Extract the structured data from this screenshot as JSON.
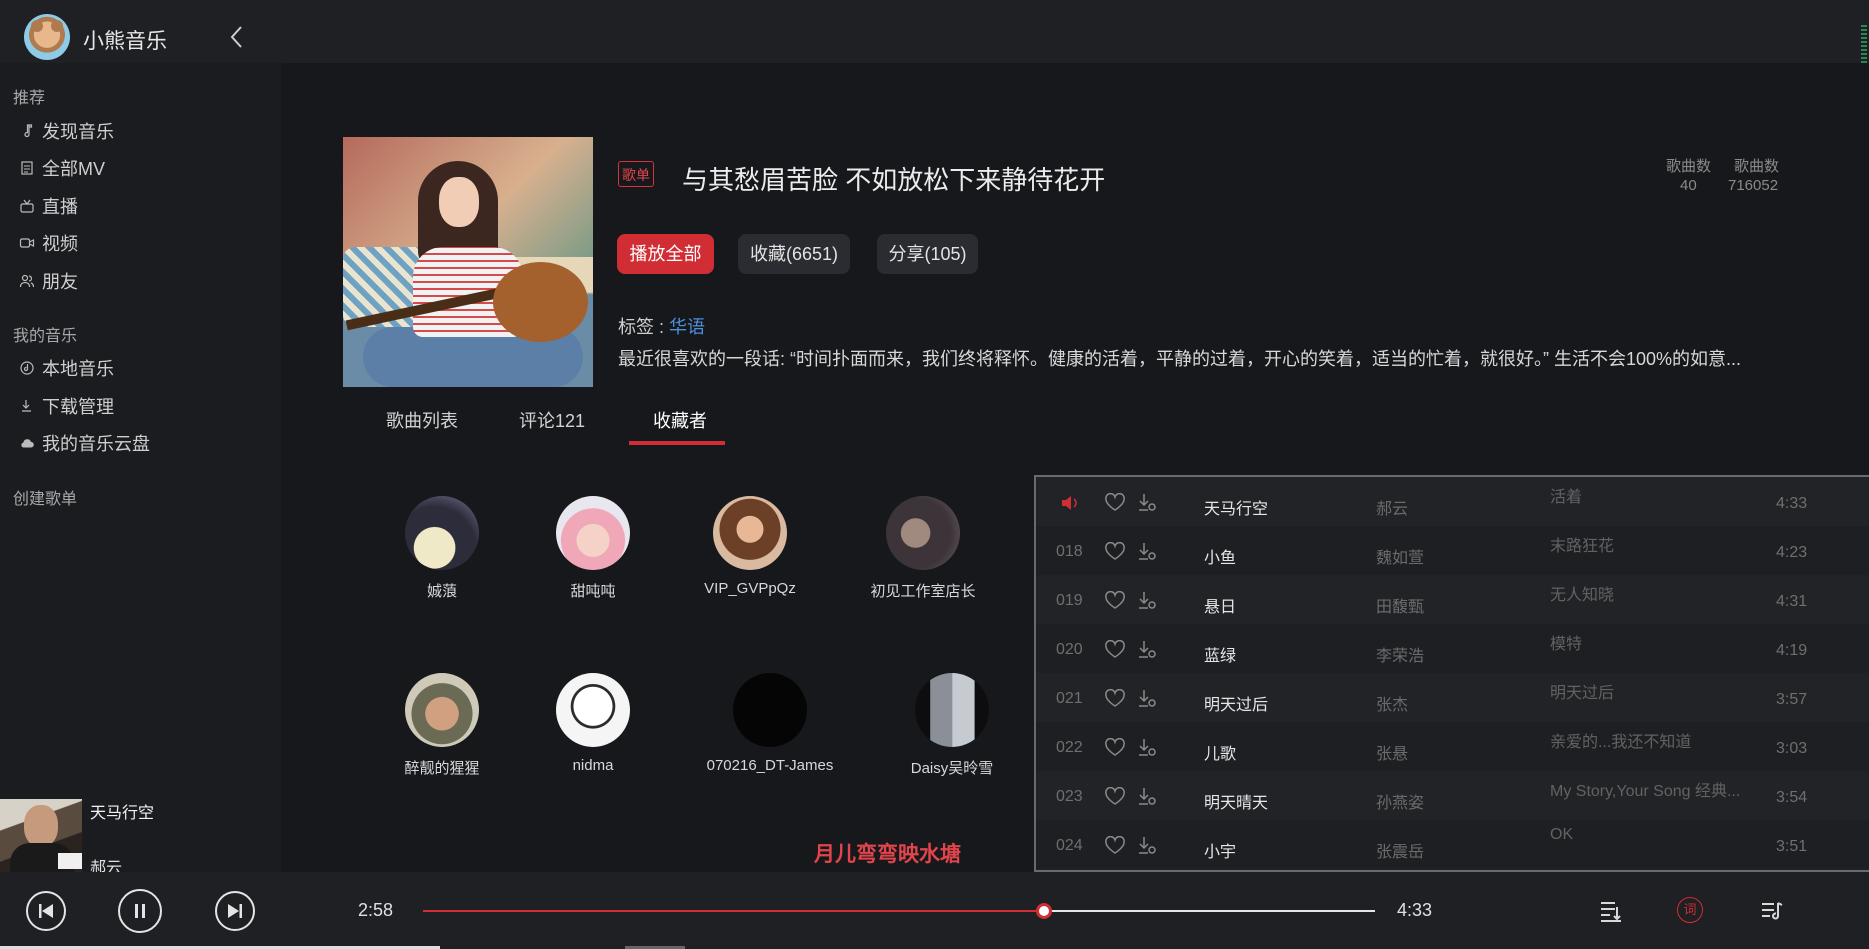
{
  "app": {
    "title": "小熊音乐"
  },
  "sidebar": {
    "sections": [
      {
        "label": "推荐"
      },
      {
        "label": "我的音乐"
      },
      {
        "label": "创建歌单"
      }
    ],
    "items": [
      {
        "label": "发现音乐",
        "icon": "music-note-icon"
      },
      {
        "label": "全部MV",
        "icon": "document-icon"
      },
      {
        "label": "直播",
        "icon": "radio-icon"
      },
      {
        "label": "视频",
        "icon": "video-icon"
      },
      {
        "label": "朋友",
        "icon": "friends-icon"
      },
      {
        "label": "本地音乐",
        "icon": "local-music-icon"
      },
      {
        "label": "下载管理",
        "icon": "download-icon"
      },
      {
        "label": "我的音乐云盘",
        "icon": "cloud-icon"
      }
    ]
  },
  "now_playing": {
    "title": "天马行空",
    "artist": "郝云"
  },
  "playlist": {
    "badge": "歌单",
    "title": "与其愁眉苦脸 不如放松下来静待花开",
    "stats": [
      {
        "label": "歌曲数",
        "value": "40"
      },
      {
        "label": "歌曲数",
        "value": "716052"
      }
    ],
    "buttons": {
      "play_all": "播放全部",
      "favorite": "收藏(6651)",
      "share": "分享(105)"
    },
    "tags_label": "标签 : ",
    "tag": "华语",
    "description": "最近很喜欢的一段话: “时间扑面而来，我们终将释怀。健康的活着，平静的过着，开心的笑着，适当的忙着，就很好。” 生活不会100%的如意..."
  },
  "tabs": [
    {
      "label": "歌曲列表"
    },
    {
      "label": "评论121"
    },
    {
      "label": "收藏者"
    }
  ],
  "subscribers": [
    {
      "name": "娍蒗"
    },
    {
      "name": "甜吨吨"
    },
    {
      "name": "VIP_GVPpQz"
    },
    {
      "name": "初见工作室店长"
    },
    {
      "name": "醉靓的猩猩"
    },
    {
      "name": "nidma"
    },
    {
      "name": "070216_DT-James"
    },
    {
      "name": "Daisy吴昤雪"
    }
  ],
  "lyric": "月儿弯弯映水塘",
  "queue": [
    {
      "num": "",
      "playing": true,
      "song": "天马行空",
      "artist": "郝云",
      "album": "活着",
      "duration": "4:33"
    },
    {
      "num": "018",
      "song": "小鱼",
      "artist": "魏如萱",
      "album": "末路狂花",
      "duration": "4:23"
    },
    {
      "num": "019",
      "song": "悬日",
      "artist": "田馥甄",
      "album": "无人知晓",
      "duration": "4:31"
    },
    {
      "num": "020",
      "song": "蓝绿",
      "artist": "李荣浩",
      "album": "模特",
      "duration": "4:19"
    },
    {
      "num": "021",
      "song": "明天过后",
      "artist": "张杰",
      "album": "明天过后",
      "duration": "3:57"
    },
    {
      "num": "022",
      "song": "儿歌",
      "artist": "张悬",
      "album": "亲爱的...我还不知道",
      "duration": "3:03"
    },
    {
      "num": "023",
      "song": "明天晴天",
      "artist": "孙燕姿",
      "album": "My Story,Your Song 经典...",
      "duration": "3:54"
    },
    {
      "num": "024",
      "song": "小宇",
      "artist": "张震岳",
      "album": "OK",
      "duration": "3:51"
    }
  ],
  "player": {
    "current_time": "2:58",
    "total_time": "4:33",
    "progress": 0.652,
    "lyric_button": "词"
  },
  "colors": {
    "accent": "#d02d34",
    "link": "#4d8fd8",
    "background": "#16181c"
  }
}
